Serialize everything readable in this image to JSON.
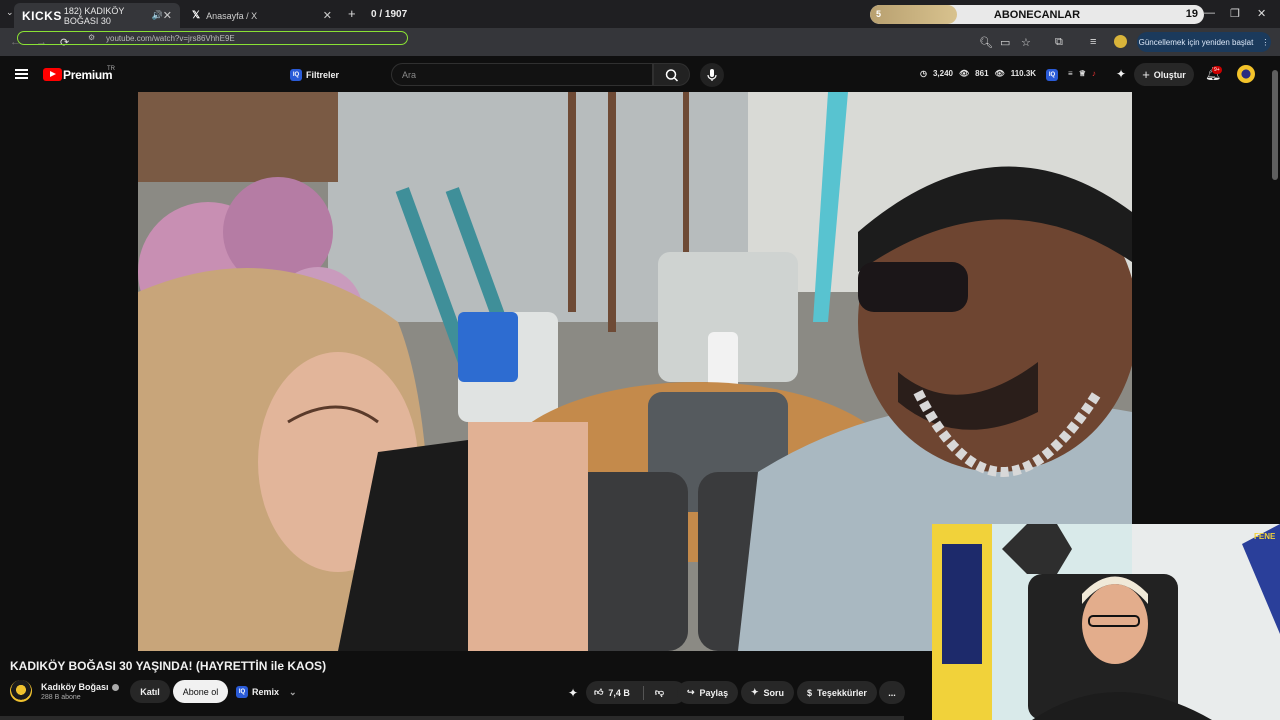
{
  "browser": {
    "tabs": [
      {
        "prefix": "KICKS",
        "label": "182) KADIKÖY BOĞASI 30",
        "active": true
      },
      {
        "label": "Anasayfa / X",
        "active": false
      }
    ],
    "new_tab": "+",
    "counter": "0 / 1907",
    "abone_bar": {
      "left": "5",
      "title": "ABONECANLAR",
      "right": "19",
      "progress": 0.26
    },
    "url": "youtube.com/watch?v=jrs86VhhE9E",
    "update_button": "Güncellemek için yeniden başlat"
  },
  "youtube": {
    "logo": "Premium",
    "region": "TR",
    "filters": "Filtreler",
    "search_placeholder": "Ara",
    "stats": [
      "3,240",
      "861",
      "110.3K"
    ],
    "create": "Oluştur",
    "notif_badge": "9+"
  },
  "video": {
    "title": "KADIKÖY BOĞASI 30 YAŞINDA! (HAYRETTİN ile KAOS)",
    "channel": "Kadıköy Boğası",
    "subscribers": "288 B abone",
    "join": "Katıl",
    "subscribe": "Abone ol",
    "remix": "Remix",
    "likes": "7,4 B",
    "share": "Paylaş",
    "ask": "Soru",
    "thanks": "Teşekkürler",
    "more": "..."
  },
  "webcam": {
    "pennant": "FENE"
  }
}
